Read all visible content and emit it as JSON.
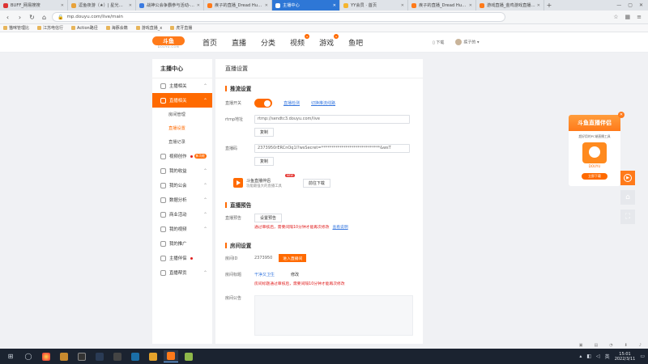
{
  "browser": {
    "tabs": [
      {
        "label": "BUFF_网易搜搜",
        "color": "#d33",
        "active": false
      },
      {
        "label": "逗鱼夜游（★）| 星光活动",
        "color": "#e8a23a",
        "active": false
      },
      {
        "label": "战神公会争霸参与活动-大月大幕",
        "color": "#3a7ae0",
        "active": false
      },
      {
        "label": "疾子的直播_Dread Hunger",
        "color": "#ff7a1a",
        "active": false
      },
      {
        "label": "主播中心",
        "color": "#fff",
        "active": true
      },
      {
        "label": "YY会员 · 首页",
        "color": "#f5b52e",
        "active": false
      },
      {
        "label": "疾子的直播_Dread Hunger",
        "color": "#ff7a1a",
        "active": false
      },
      {
        "label": "游戏直播_金鸡游戏直播平台",
        "color": "#ff7a1a",
        "active": false
      }
    ],
    "url": "mp.douyu.com/live/main",
    "bookmarks": [
      "猫咪管理比",
      "江苏电信行",
      "Action路径",
      "海豚会籍",
      "游戏直播_x",
      "虎牙直播"
    ]
  },
  "header": {
    "logo_text": "斗鱼",
    "logo_sub": "DOUYU.COM",
    "nav": [
      "首页",
      "直播",
      "分类",
      "视频",
      "游戏",
      "鱼吧"
    ],
    "download": "下载",
    "username": "疾子的"
  },
  "sidebar": {
    "title": "主播中心",
    "items": [
      {
        "label": "主播相关",
        "chev": "^"
      },
      {
        "label": "直播相关",
        "chev": "^",
        "active": true
      },
      {
        "label": "视频创作",
        "chev": "^",
        "dot": true,
        "pill": "新功能"
      },
      {
        "label": "我的收益",
        "chev": "^"
      },
      {
        "label": "我的公会",
        "chev": "^"
      },
      {
        "label": "数据分析",
        "chev": "^"
      },
      {
        "label": "商业活动",
        "chev": "^"
      },
      {
        "label": "我的视频",
        "chev": "^"
      },
      {
        "label": "我的推广",
        "chev": ""
      },
      {
        "label": "主播伴侣",
        "chev": "",
        "dot": true
      },
      {
        "label": "直播帮贡",
        "chev": "^"
      }
    ],
    "subitems": [
      "房间管理",
      "直播设置",
      "直播记录"
    ]
  },
  "main": {
    "page_title": "直播设置",
    "push": {
      "heading": "推流设置",
      "switch_label": "直播开关",
      "link1": "直播检测",
      "link2": "切换推流线路",
      "rtmp_label": "rtmp地址",
      "rtmp_value": "rtmp://sendtc3.douyu.com/live",
      "copy": "复制",
      "code_label": "直播码",
      "code_value": "2373950rERCnOq1l?wsSecret=*****************************&wsT",
      "tool_name": "斗鱼直播伴侣",
      "tool_desc": "功能最强大的直播工具",
      "tool_new": "NEW",
      "tool_btn": "前往下载"
    },
    "preview": {
      "heading": "直播预告",
      "label": "直播预告",
      "btn": "设置预告",
      "warn": "通过审核后，需要间隔10分钟才能再次修改",
      "link": "查看说明"
    },
    "room": {
      "heading": "房间设置",
      "id_label": "房间ID",
      "id_value": "2373950",
      "id_btn": "进入直播间",
      "title_label": "房间标题",
      "title_value": "干净又卫生",
      "edit": "修改",
      "title_warn": "房间标题通过审核后，需要间隔10分钟才能再次修改",
      "notice_label": "房间公告"
    }
  },
  "ad": {
    "title": "斗鱼直播伴侣",
    "sub": "超好用的PC端直播工具",
    "badge": "DOUYU",
    "btn": "立即下载"
  },
  "taskbar": {
    "time": "15:01",
    "date": "2022/3/11"
  },
  "colors": {
    "accent": "#ff6a00",
    "link": "#3a7ae0",
    "warn": "#e02020"
  }
}
